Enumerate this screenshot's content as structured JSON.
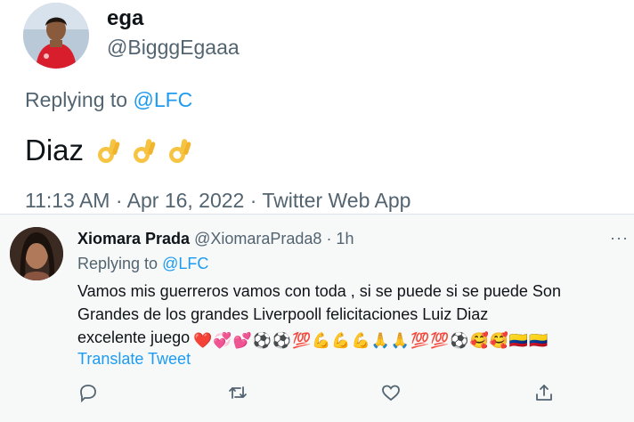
{
  "tweet": {
    "display_name": "ega",
    "handle": "@BigggEgaaa",
    "replying_prefix": "Replying to",
    "replying_to": "@LFC",
    "text": "Diaz",
    "emoji": [
      "ok-hand",
      "ok-hand",
      "ok-hand"
    ],
    "meta": "11:13 AM · Apr 16, 2022 · Twitter Web App"
  },
  "reply": {
    "display_name": "Xiomara Prada",
    "handle": "@XiomaraPrada8",
    "time": "· 1h",
    "more": "···",
    "replying_prefix": "Replying to",
    "replying_to": "@LFC",
    "lines": [
      "Vamos mis guerreros vamos con toda , si se puede si se puede Son",
      "Grandes de los grandes  Liverpooll felicitaciones  Luiz Diaz",
      "excelente juego"
    ],
    "emoji_sequence": [
      "❤️",
      "💞",
      "💕",
      "⚽",
      "⚽",
      "💯",
      "💪",
      "💪",
      "💪",
      "🙏",
      "🙏",
      "💯",
      "💯",
      "⚽",
      "🥰",
      "🥰",
      "🇨🇴",
      "🇨🇴"
    ],
    "translate": "Translate Tweet",
    "actions": [
      "reply-icon",
      "retweet-icon",
      "like-icon",
      "share-icon"
    ]
  },
  "colors": {
    "accent": "#1d9bf0",
    "secondary_text": "#536471",
    "primary_text": "#0f1419",
    "reply_bg": "#f7f8f8"
  }
}
